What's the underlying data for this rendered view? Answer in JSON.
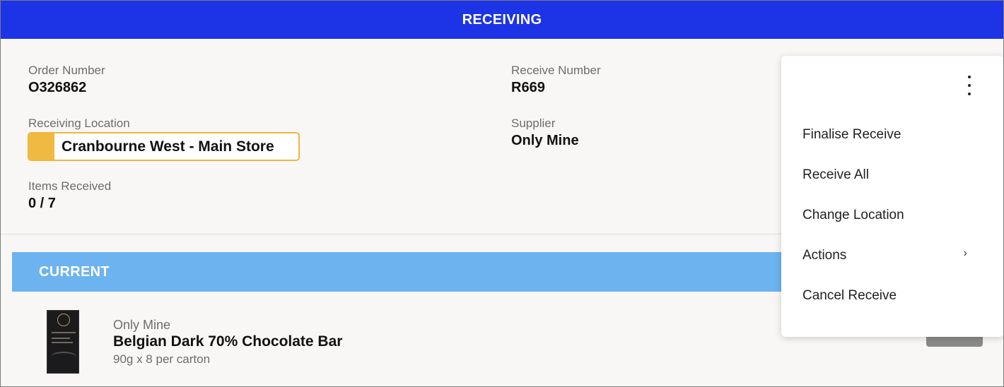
{
  "header": {
    "title": "RECEIVING"
  },
  "order": {
    "order_number_label": "Order Number",
    "order_number": "O326862",
    "receive_number_label": "Receive Number",
    "receive_number": "R669",
    "location_label": "Receiving Location",
    "location": "Cranbourne West - Main Store",
    "supplier_label": "Supplier",
    "supplier": "Only Mine",
    "items_received_label": "Items Received",
    "items_received": "0 / 7"
  },
  "section": {
    "title": "CURRENT"
  },
  "items": [
    {
      "supplier": "Only Mine",
      "name": "Belgian Dark 70% Chocolate Bar",
      "pack_size": "90g x 8 per carton"
    }
  ],
  "menu": {
    "items": [
      {
        "label": "Finalise Receive"
      },
      {
        "label": "Receive All"
      },
      {
        "label": "Change Location"
      },
      {
        "label": "Actions",
        "submenu_icon": "chevron-right-icon",
        "submenu_glyph": "›"
      },
      {
        "label": "Cancel Receive"
      }
    ]
  },
  "colors": {
    "header_bg": "#1d33e6",
    "section_bg": "#6cb3f0",
    "location_accent": "#f0b942"
  },
  "icons": {
    "menu": "kebab-menu-icon"
  }
}
